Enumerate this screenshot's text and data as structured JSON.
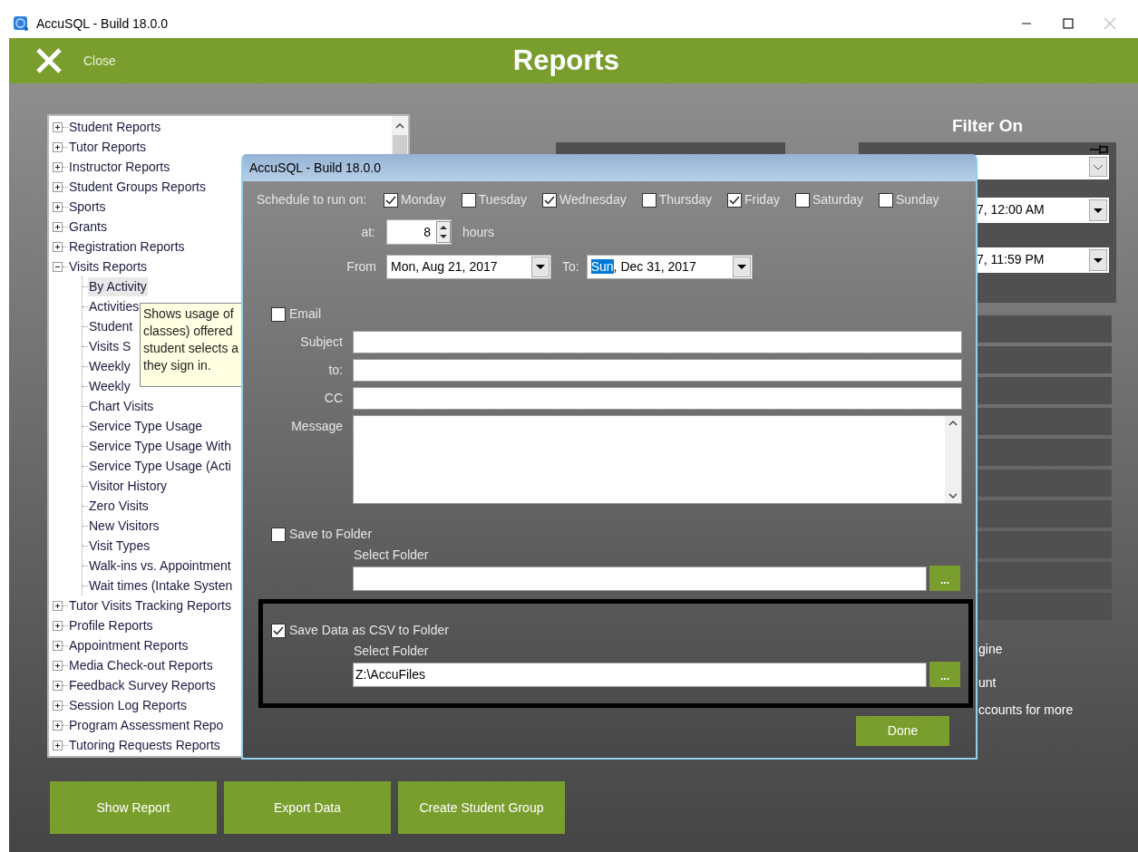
{
  "window": {
    "title": "AccuSQL - Build 18.0.0"
  },
  "header": {
    "close_label": "Close",
    "title": "Reports"
  },
  "report_tree": {
    "items": [
      {
        "label": "Student Reports",
        "expanded": false,
        "selected": false
      },
      {
        "label": "Tutor Reports",
        "expanded": false,
        "selected": false
      },
      {
        "label": "Instructor Reports",
        "expanded": false,
        "selected": false
      },
      {
        "label": "Student Groups Reports",
        "expanded": false,
        "selected": false
      },
      {
        "label": "Sports",
        "expanded": false,
        "selected": false
      },
      {
        "label": "Grants",
        "expanded": false,
        "selected": false
      },
      {
        "label": "Registration Reports",
        "expanded": false,
        "selected": false
      },
      {
        "label": "Visits Reports",
        "expanded": true,
        "selected": false,
        "children": [
          {
            "label": "By Activity",
            "selected": true
          },
          {
            "label": "Activities",
            "selected": false
          },
          {
            "label": "Student",
            "selected": false
          },
          {
            "label": "Visits S",
            "selected": false
          },
          {
            "label": "Weekly",
            "selected": false
          },
          {
            "label": "Weekly",
            "selected": false
          },
          {
            "label": "Chart Visits",
            "selected": false
          },
          {
            "label": "Service Type Usage",
            "selected": false
          },
          {
            "label": "Service Type Usage With",
            "selected": false
          },
          {
            "label": "Service Type Usage (Acti",
            "selected": false
          },
          {
            "label": "Visitor History",
            "selected": false
          },
          {
            "label": "Zero Visits",
            "selected": false
          },
          {
            "label": "New Visitors",
            "selected": false
          },
          {
            "label": "Visit Types",
            "selected": false
          },
          {
            "label": "Walk-ins vs. Appointment",
            "selected": false
          },
          {
            "label": "Wait times (Intake Systen",
            "selected": false
          }
        ]
      },
      {
        "label": "Tutor Visits Tracking Reports",
        "expanded": false,
        "selected": false
      },
      {
        "label": "Profile Reports",
        "expanded": false,
        "selected": false
      },
      {
        "label": "Appointment Reports",
        "expanded": false,
        "selected": false
      },
      {
        "label": "Media Check-out Reports",
        "expanded": false,
        "selected": false
      },
      {
        "label": "Feedback Survey Reports",
        "expanded": false,
        "selected": false
      },
      {
        "label": "Session Log Reports",
        "expanded": false,
        "selected": false
      },
      {
        "label": "Program Assessment Repo",
        "expanded": false,
        "selected": false
      },
      {
        "label": "Tutoring Requests Reports",
        "expanded": false,
        "selected": false
      }
    ]
  },
  "tooltip": {
    "lines": [
      "Shows usage of",
      "classes) offered",
      "student selects a",
      "they sign in."
    ]
  },
  "filter": {
    "title": "Filter On",
    "start": "7, 12:00 AM",
    "end": "7, 11:59 PM"
  },
  "options_text": [
    "gine",
    "unt",
    "ccounts for more"
  ],
  "buttons": [
    "Show Report",
    "Export Data",
    "Create Student Group"
  ],
  "dialog": {
    "title": "AccuSQL - Build 18.0.0",
    "schedule_label": "Schedule to run on:",
    "days": [
      {
        "label": "Monday",
        "checked": true
      },
      {
        "label": "Tuesday",
        "checked": false
      },
      {
        "label": "Wednesday",
        "checked": true
      },
      {
        "label": "Thursday",
        "checked": false
      },
      {
        "label": "Friday",
        "checked": true
      },
      {
        "label": "Saturday",
        "checked": false
      },
      {
        "label": "Sunday",
        "checked": false
      }
    ],
    "at_label": "at:",
    "hours_value": "8",
    "hours_label": "hours",
    "from_label": "From",
    "from_date": "Mon, Aug 21, 2017",
    "to_label": "To:",
    "to_date_selected": "Sun",
    "to_date_rest": ", Dec 31, 2017",
    "email": {
      "label": "Email",
      "checked": false
    },
    "email_fields": [
      {
        "label": "Subject"
      },
      {
        "label": "to:"
      },
      {
        "label": "CC"
      }
    ],
    "message_label": "Message",
    "folder_sections": [
      {
        "label": "Save to Folder",
        "checked": false,
        "highlighted": false,
        "select_label": "Select Folder",
        "browse": "..."
      },
      {
        "label": "Save Data as CSV to Folder",
        "checked": true,
        "highlighted": true,
        "select_label": "Select Folder",
        "value": "Z:\\AccuFiles",
        "browse": "..."
      }
    ],
    "done": "Done"
  }
}
